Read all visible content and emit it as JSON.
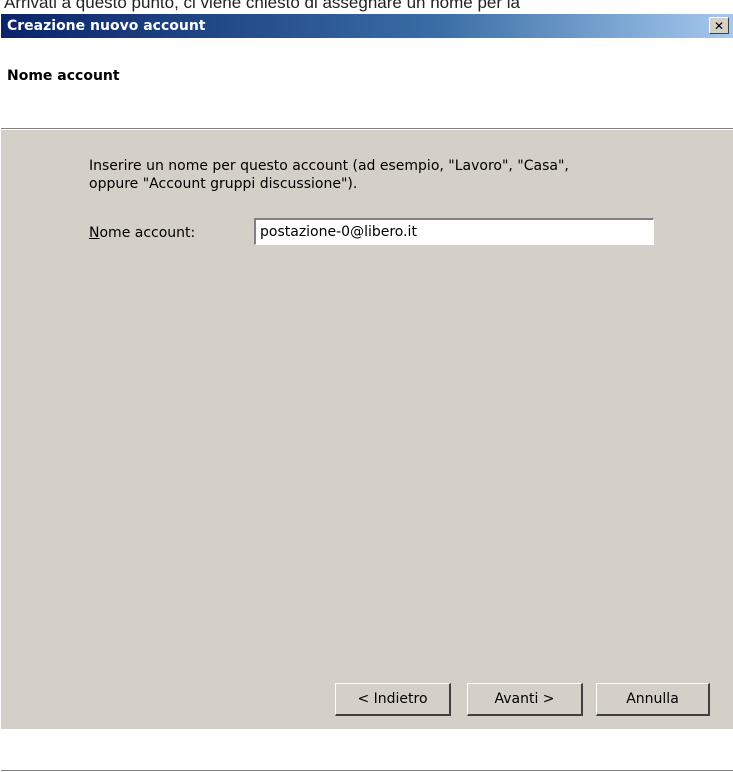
{
  "page_caption": "Arrivati a questo punto, ci viene chiesto di assegnare un nome per la",
  "window": {
    "title": "Creazione nuovo account",
    "close_glyph": "✕"
  },
  "header": {
    "title": "Nome account"
  },
  "form": {
    "instructions_line1": "Inserire un nome per questo account (ad esempio, \"Lavoro\", \"Casa\",",
    "instructions_line2": "oppure \"Account gruppi discussione\").",
    "label_mnemonic": "N",
    "label_rest": "ome account:",
    "value": "postazione-0@libero.it"
  },
  "buttons": {
    "back": "< Indietro",
    "next": "Avanti >",
    "cancel": "Annulla"
  },
  "colors": {
    "titlebar_start": "#0a246a",
    "titlebar_end": "#a6caf0",
    "dialog_bg": "#d4d0c8"
  }
}
